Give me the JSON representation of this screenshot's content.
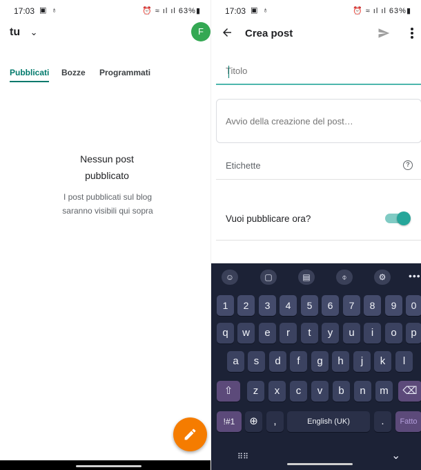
{
  "left": {
    "status": {
      "time": "17:03",
      "left_icons": "▣ ♁",
      "right_icons": "⏰ ≈ ıl ıl",
      "battery": "63%▮"
    },
    "header": {
      "account": "tu",
      "avatar_letter": "F"
    },
    "tabs": [
      {
        "label": "Pubblicati",
        "active": true
      },
      {
        "label": "Bozze",
        "active": false
      },
      {
        "label": "Programmati",
        "active": false
      }
    ],
    "empty": {
      "title_line1": "Nessun post",
      "title_line2": "pubblicato",
      "sub_line1": "I post pubblicati sul blog",
      "sub_line2": "saranno visibili qui sopra"
    },
    "fab": {
      "icon": "pencil-icon",
      "color": "#f57c00"
    }
  },
  "right": {
    "status": {
      "time": "17:03",
      "left_icons": "▣ ♁",
      "right_icons": "⏰ ≈ ıl ıl",
      "battery": "63%▮"
    },
    "toolbar": {
      "title": "Crea post"
    },
    "fields": {
      "title_placeholder": "Titolo",
      "body_placeholder": "Avvio della creazione del post…",
      "labels_placeholder": "Etichette",
      "help_glyph": "?"
    },
    "publish": {
      "label": "Vuoi pubblicare ora?",
      "enabled": true
    },
    "keyboard": {
      "toolbar": [
        "☺",
        "▢",
        "▤",
        "⌽",
        "⚙"
      ],
      "dots": "•••",
      "numbers": [
        "1",
        "2",
        "3",
        "4",
        "5",
        "6",
        "7",
        "8",
        "9",
        "0"
      ],
      "row1": [
        "q",
        "w",
        "e",
        "r",
        "t",
        "y",
        "u",
        "i",
        "o",
        "p"
      ],
      "row2": [
        "a",
        "s",
        "d",
        "f",
        "g",
        "h",
        "j",
        "k",
        "l"
      ],
      "row3": [
        "z",
        "x",
        "c",
        "v",
        "b",
        "n",
        "m"
      ],
      "shift": "⇧",
      "backspace": "⌫",
      "symbols": "!#1",
      "globe": "⊕",
      "comma": ",",
      "space": "English (UK)",
      "period": ".",
      "done": "Fatto",
      "nav_grid": "⠿⠿",
      "nav_down": "⌄"
    }
  }
}
